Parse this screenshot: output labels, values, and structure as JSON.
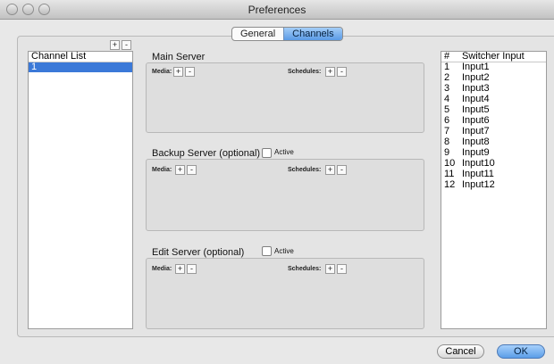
{
  "window": {
    "title": "Preferences"
  },
  "tabs": [
    {
      "label": "General",
      "selected": false
    },
    {
      "label": "Channels",
      "selected": true
    }
  ],
  "channel_list": {
    "header": "Channel List",
    "add_label": "+",
    "remove_label": "-",
    "items": [
      {
        "label": "1",
        "selected": true
      }
    ]
  },
  "main_server": {
    "title": "Main Server",
    "media_label": "Media:",
    "schedules_label": "Schedules:",
    "add_label": "+",
    "remove_label": "-"
  },
  "backup_server": {
    "title": "Backup Server (optional)",
    "active_label": "Active",
    "active_checked": false,
    "media_label": "Media:",
    "schedules_label": "Schedules:",
    "add_label": "+",
    "remove_label": "-"
  },
  "edit_server": {
    "title": "Edit Server (optional)",
    "active_label": "Active",
    "active_checked": false,
    "media_label": "Media:",
    "schedules_label": "Schedules:",
    "add_label": "+",
    "remove_label": "-"
  },
  "switcher_table": {
    "col_number": "#",
    "col_input": "Switcher Input",
    "rows": [
      {
        "num": "1",
        "input": "Input1"
      },
      {
        "num": "2",
        "input": "Input2"
      },
      {
        "num": "3",
        "input": "Input3"
      },
      {
        "num": "4",
        "input": "Input4"
      },
      {
        "num": "5",
        "input": "Input5"
      },
      {
        "num": "6",
        "input": "Input6"
      },
      {
        "num": "7",
        "input": "Input7"
      },
      {
        "num": "8",
        "input": "Input8"
      },
      {
        "num": "9",
        "input": "Input9"
      },
      {
        "num": "10",
        "input": "Input10"
      },
      {
        "num": "11",
        "input": "Input11"
      },
      {
        "num": "12",
        "input": "Input12"
      }
    ]
  },
  "buttons": {
    "cancel": "Cancel",
    "ok": "OK"
  },
  "colors": {
    "accent": "#3b79d8",
    "window_bg": "#e8e8e8",
    "default_button": "#5b9de8"
  }
}
